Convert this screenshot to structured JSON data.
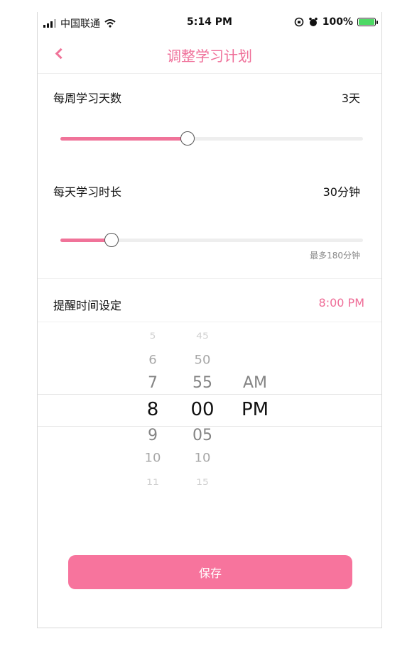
{
  "status_bar": {
    "carrier": "中国联通",
    "time": "5:14 PM",
    "battery": "100%"
  },
  "nav": {
    "title": "调整学习计划"
  },
  "weekly_days": {
    "label": "每周学习天数",
    "value": "3天",
    "slider_fraction": 0.42
  },
  "daily_duration": {
    "label": "每天学习时长",
    "value": "30分钟",
    "slider_fraction": 0.17,
    "hint": "最多180分钟"
  },
  "reminder": {
    "label": "提醒时间设定",
    "value": "8:00 PM"
  },
  "picker": {
    "hours": [
      "5",
      "6",
      "7",
      "8",
      "9",
      "10",
      "11"
    ],
    "minutes": [
      "45",
      "50",
      "55",
      "00",
      "05",
      "10",
      "15"
    ],
    "periods": [
      "AM",
      "PM"
    ]
  },
  "save_label": "保存",
  "colors": {
    "accent": "#ef6e98",
    "button": "#f7749d"
  }
}
